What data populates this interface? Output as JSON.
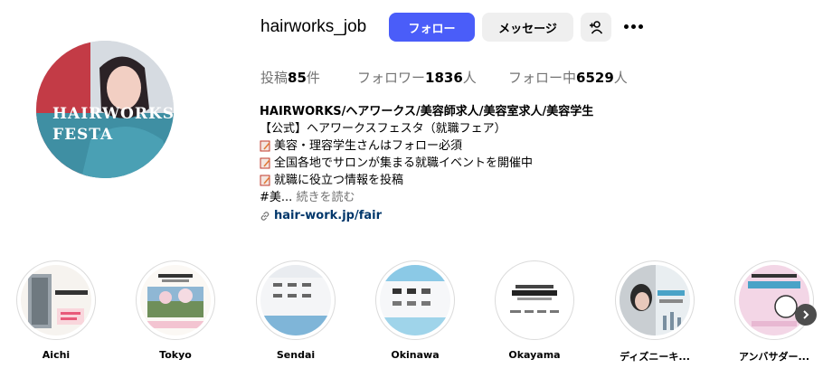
{
  "profile": {
    "username": "hairworks_job",
    "avatar_text_line1": "HAIRWORKS",
    "avatar_text_line2": "FESTA"
  },
  "actions": {
    "follow_label": "フォロー",
    "message_label": "メッセージ",
    "suggest_icon": "person-add-icon",
    "more_icon": "more-horizontal-icon"
  },
  "stats": {
    "posts_label": "投稿",
    "posts_value": "85",
    "posts_unit": "件",
    "followers_label": "フォロワー",
    "followers_value": "1836",
    "followers_unit": "人",
    "following_label": "フォロー中",
    "following_value": "6529",
    "following_unit": "人"
  },
  "bio": {
    "name": "HAIRWORKS/ヘアワークス/美容師求人/美容室求人/美容学生",
    "line1": "【公式】ヘアワークスフェスタ（就職フェア）",
    "line2": "美容・理容学生さんはフォロー必須",
    "line3": "全国各地でサロンが集まる就職イベントを開催中",
    "line4": "就職に役立つ情報を投稿",
    "line5_prefix": "#美...",
    "more_label": "続きを読む",
    "link": "hair-work.jp/fair"
  },
  "highlights": [
    {
      "label": "Aichi"
    },
    {
      "label": "Tokyo"
    },
    {
      "label": "Sendai"
    },
    {
      "label": "Okinawa"
    },
    {
      "label": "Okayama"
    },
    {
      "label": "ディズニーキ..."
    },
    {
      "label": "アンバサダー..."
    }
  ],
  "colors": {
    "follow_button": "#4a5df9",
    "secondary_button": "#efefef",
    "link": "#00376b",
    "muted_text": "#737373"
  }
}
